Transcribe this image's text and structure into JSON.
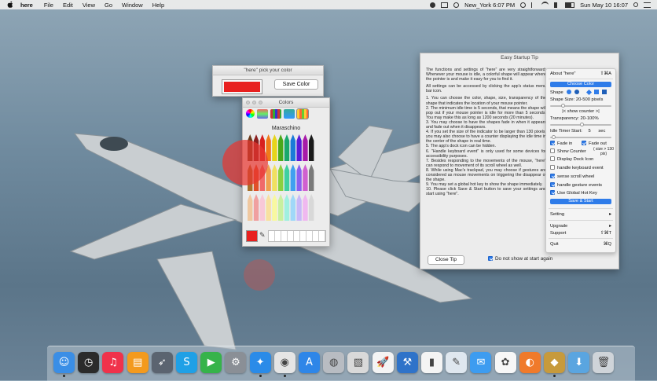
{
  "menubar": {
    "app_name": "here",
    "menus": [
      "File",
      "Edit",
      "View",
      "Go",
      "Window",
      "Help"
    ],
    "clock_city": "New_York 6:07 PM",
    "datetime": "Sun May 10  16:07"
  },
  "picker_window": {
    "title": "\"here\" pick your color",
    "save_color_label": "Save Color",
    "selected_color": "#e8201f"
  },
  "colors_panel": {
    "title": "Colors",
    "color_name": "Maraschino"
  },
  "tip_window": {
    "title": "Easy Startup Tip",
    "paragraphs": [
      "The functions and settings of \"here\" are very straightforward: Whenever your mouse is idle, a colorful shape will appear where the pointer is and make it easy for you to find it.",
      "All settings can be accessed by clicking the app's status menu bar icon.",
      "1.    You can choose the color, shape, size, transparency of the shape that indicates the location of your mouse pointer.",
      "2.    The minimum idle time is 5 seconds, that means the shape will pop out if your mouse pointer is idle for more than 5 seconds. You may make this as long as 1200 seconds (20 minutes).",
      "3.    You may choose to have the shapes fade in when it appears and fade out when it disappears.",
      "4.    If you set the size of the indicator to be larger than 130 pixels, you may also choose to have a counter displaying the idle time in the center of the shape in real time.",
      "5.    The app's dock icon can be hidden.",
      "6.    \"Handle keyboard event\" is only used for some devices for accessibility purposes.",
      "7.    Besides responding to the movements of the mouse, \"here\" can respond to movement of its scroll wheel as well.",
      "8.    While using Mac's trackpad, you may choose if gestures are considered as mouse movements on triggering the disappear of the shape.",
      "9.    You may set a global hot key to show the shape immediately.",
      "10.   Please click Save & Start button to save your settings and start using \"here\"."
    ],
    "close_tip_label": "Close Tip",
    "dont_show_label": "Do not show at start again"
  },
  "status_menu": {
    "about": "About \"here\"",
    "about_shortcut": "⇧⌘A",
    "choose_color": "Choose Color",
    "shape_label": "Shape",
    "shape_size": "Shape Size: 20-500 pixels",
    "show_counter_note": "|< show counter >|",
    "transparency": "Transparency: 20-100%",
    "idle_timer_label": "Idle Timer Start:",
    "idle_timer_value": "5",
    "idle_timer_unit": "sec",
    "fade_in": "Fade in",
    "fade_out": "Fade out",
    "show_counter": "Show Counter",
    "show_counter_size": "( size > 130 pix)",
    "display_dock_icon": "Display Dock Icon",
    "handle_keyboard": "handle keyboard event",
    "sense_scroll": "sense scroll wheel",
    "handle_gesture": "handle gesture events",
    "use_hotkey": "Use Global Hot Key",
    "save_start": "Save & Start",
    "setting": "Setting",
    "upgrade": "Upgrade",
    "support": "Support",
    "support_shortcut": "⇧⌘T",
    "quit": "Quit",
    "quit_shortcut": "⌘Q",
    "arrow": "▸"
  },
  "dock": {
    "icons": [
      {
        "name": "finder",
        "color": "#3a8ee6",
        "glyph": "☺"
      },
      {
        "name": "dashboard",
        "color": "#2b2b2b",
        "glyph": "◷"
      },
      {
        "name": "music",
        "color": "#f0324b",
        "glyph": "♫"
      },
      {
        "name": "ibooks",
        "color": "#f39a1e",
        "glyph": "▤"
      },
      {
        "name": "launchpad",
        "color": "#5b6470",
        "glyph": "➶"
      },
      {
        "name": "skype",
        "color": "#1fa0e6",
        "glyph": "S"
      },
      {
        "name": "facetime",
        "color": "#36b34a",
        "glyph": "▶"
      },
      {
        "name": "system-preferences",
        "color": "#8a8f96",
        "glyph": "⚙"
      },
      {
        "name": "safari",
        "color": "#2a8be8",
        "glyph": "✦"
      },
      {
        "name": "chrome",
        "color": "#e5e5e5",
        "glyph": "◉"
      },
      {
        "name": "app-store",
        "color": "#2e86e8",
        "glyph": "A"
      },
      {
        "name": "disk-utility",
        "color": "#b8bcc2",
        "glyph": "◍"
      },
      {
        "name": "preview",
        "color": "#d9d9d9",
        "glyph": "▧"
      },
      {
        "name": "rocket",
        "color": "#f4f4f4",
        "glyph": "🚀"
      },
      {
        "name": "xcode",
        "color": "#2f73c9",
        "glyph": "⚒"
      },
      {
        "name": "numbers",
        "color": "#f4f4f4",
        "glyph": "▮"
      },
      {
        "name": "sketch-app",
        "color": "#dfe7ef",
        "glyph": "✎"
      },
      {
        "name": "messages",
        "color": "#3d9cf0",
        "glyph": "✉"
      },
      {
        "name": "photos",
        "color": "#f7f7f7",
        "glyph": "✿"
      },
      {
        "name": "color-app",
        "color": "#f07a2a",
        "glyph": "◐"
      },
      {
        "name": "here-app",
        "color": "#c79a3c",
        "glyph": "◆"
      },
      {
        "name": "downloads-folder",
        "color": "#5aa5e0",
        "glyph": "⬇"
      },
      {
        "name": "trash",
        "color": "#cfd4d9",
        "glyph": "🗑"
      }
    ]
  }
}
